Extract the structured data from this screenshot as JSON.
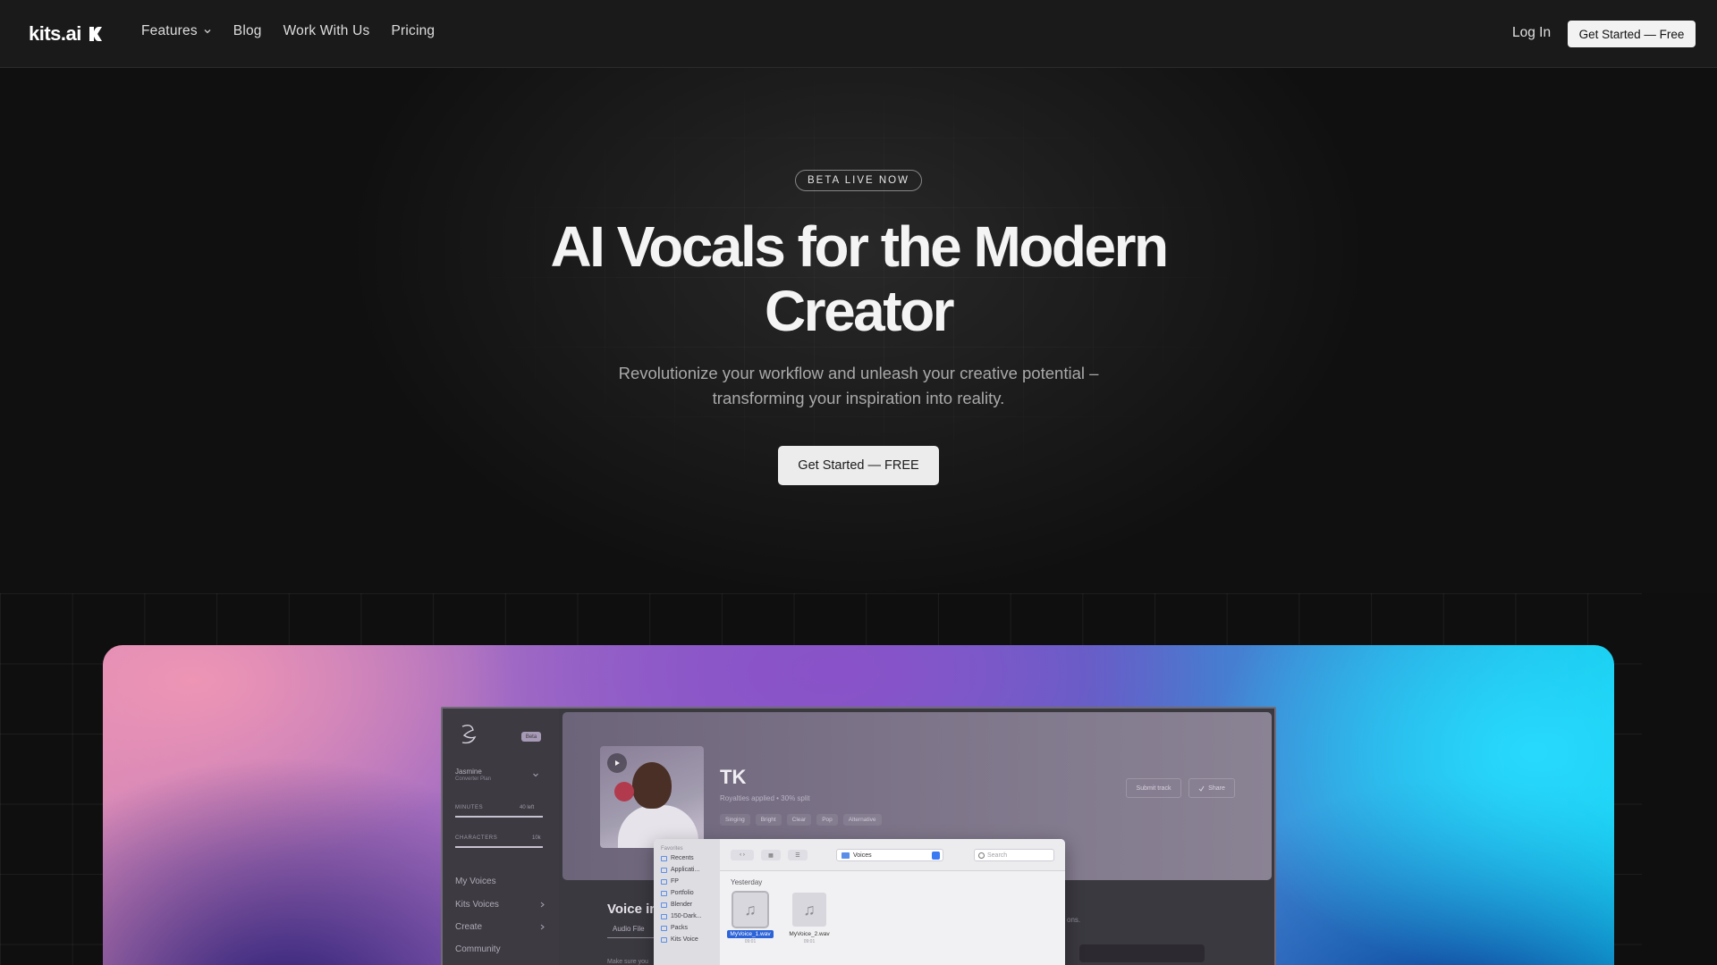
{
  "nav": {
    "logo_text": "kits.ai",
    "links": [
      {
        "label": "Features",
        "has_dropdown": true
      },
      {
        "label": "Blog"
      },
      {
        "label": "Work With Us"
      },
      {
        "label": "Pricing"
      }
    ],
    "login_label": "Log In",
    "cta_label": "Get Started — Free"
  },
  "hero": {
    "badge": "BETA LIVE NOW",
    "headline_line1": "AI Vocals for the Modern",
    "headline_line2": "Creator",
    "subhead_line1": "Revolutionize your workflow and unleash your creative potential –",
    "subhead_line2": "transforming your inspiration into reality.",
    "cta_label": "Get Started — FREE"
  },
  "app_preview": {
    "beta_pill": "Beta",
    "user_name": "Jasmine",
    "user_plan": "Converter Plan",
    "meters": [
      {
        "label": "MINUTES",
        "value": "40 left"
      },
      {
        "label": "CHARACTERS",
        "value": "10k"
      }
    ],
    "side_nav": [
      {
        "label": "My Voices",
        "has_chevron": false
      },
      {
        "label": "Kits Voices",
        "has_chevron": true
      },
      {
        "label": "Create",
        "has_chevron": true
      },
      {
        "label": "Community",
        "has_chevron": false
      }
    ],
    "artist": {
      "name": "TK",
      "subtitle": "Royalties applied • 30% split",
      "tags": [
        "Singing",
        "Bright",
        "Clear",
        "Pop",
        "Alternative"
      ],
      "submit_label": "Submit track",
      "share_label": "Share"
    },
    "voice_section_title": "Voice in",
    "audio_tab": "Audio File",
    "audio_note": "Make sure you",
    "snippet_text": "ons.",
    "finder": {
      "sidebar_title": "Favorites",
      "sidebar_items": [
        "Recents",
        "Applicati...",
        "FP",
        "Portfolio",
        "Blender",
        "150-Dark...",
        "Packs",
        "Kits Voice"
      ],
      "folder": "Voices",
      "search_placeholder": "Search",
      "group_label": "Yesterday",
      "files": [
        {
          "name": "MyVoice_1.wav",
          "time": "09:01",
          "selected": true
        },
        {
          "name": "MyVoice_2.wav",
          "time": "09:01",
          "selected": false
        }
      ]
    }
  },
  "colors": {
    "background": "#0f0f0f",
    "cta_background": "#ececec",
    "gradient_pink": "#f096b4",
    "gradient_purple": "#8c50c8",
    "gradient_cyan": "#28dcff",
    "selection_blue": "#2d63d8"
  },
  "icons": [
    "kits-logo-icon",
    "chevron-down-icon",
    "play-icon",
    "music-note-icon",
    "search-icon",
    "folder-icon",
    "share-icon"
  ]
}
